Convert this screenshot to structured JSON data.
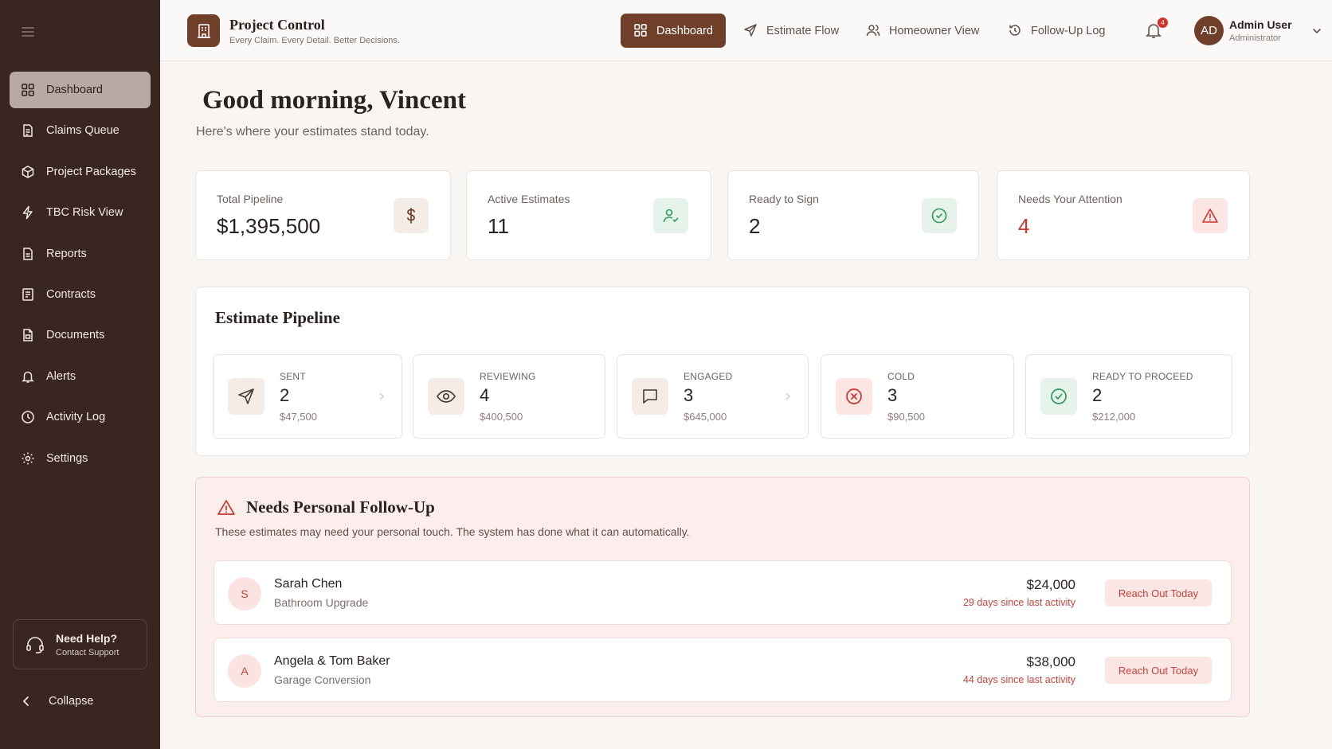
{
  "sidebar": {
    "items": [
      {
        "label": "Dashboard",
        "icon": "grid-icon",
        "active": true
      },
      {
        "label": "Claims Queue",
        "icon": "document-icon"
      },
      {
        "label": "Project Packages",
        "icon": "package-icon"
      },
      {
        "label": "TBC Risk View",
        "icon": "lightning-icon"
      },
      {
        "label": "Reports",
        "icon": "report-icon"
      },
      {
        "label": "Contracts",
        "icon": "contract-icon"
      },
      {
        "label": "Documents",
        "icon": "documents-icon"
      },
      {
        "label": "Alerts",
        "icon": "bell-icon"
      },
      {
        "label": "Activity Log",
        "icon": "clock-icon"
      },
      {
        "label": "Settings",
        "icon": "gear-icon"
      }
    ],
    "help": {
      "title": "Need Help?",
      "subtitle": "Contact Support"
    },
    "collapse_label": "Collapse"
  },
  "header": {
    "brand_title": "Project Control",
    "brand_subtitle": "Every Claim. Every Detail. Better Decisions.",
    "nav": [
      {
        "label": "Dashboard",
        "icon": "grid-icon",
        "active": true
      },
      {
        "label": "Estimate Flow",
        "icon": "send-icon"
      },
      {
        "label": "Homeowner View",
        "icon": "users-icon"
      },
      {
        "label": "Follow-Up Log",
        "icon": "history-icon"
      }
    ],
    "notification_count": "4",
    "user": {
      "initials": "AD",
      "name": "Admin User",
      "role": "Administrator"
    }
  },
  "main": {
    "greeting": "Good morning, Vincent",
    "subtitle": "Here's where your estimates stand today.",
    "stats": [
      {
        "label": "Total Pipeline",
        "value": "$1,395,500",
        "icon": "dollar-icon"
      },
      {
        "label": "Active Estimates",
        "value": "11",
        "icon": "user-check-icon"
      },
      {
        "label": "Ready to Sign",
        "value": "2",
        "icon": "check-circle-icon"
      },
      {
        "label": "Needs Your Attention",
        "value": "4",
        "icon": "warning-icon"
      }
    ],
    "pipeline": {
      "title": "Estimate Pipeline",
      "stages": [
        {
          "name": "SENT",
          "count": "2",
          "amount": "$47,500",
          "icon": "send-icon"
        },
        {
          "name": "REVIEWING",
          "count": "4",
          "amount": "$400,500",
          "icon": "eye-icon"
        },
        {
          "name": "ENGAGED",
          "count": "3",
          "amount": "$645,000",
          "icon": "chat-icon"
        },
        {
          "name": "COLD",
          "count": "3",
          "amount": "$90,500",
          "icon": "x-circle-icon"
        },
        {
          "name": "READY TO PROCEED",
          "count": "2",
          "amount": "$212,000",
          "icon": "check-circle-icon"
        }
      ]
    },
    "followup": {
      "title": "Needs Personal Follow-Up",
      "description": "These estimates may need your personal touch. The system has done what it can automatically.",
      "rows": [
        {
          "initial": "S",
          "name": "Sarah Chen",
          "project": "Bathroom Upgrade",
          "amount": "$24,000",
          "days": "29 days since last activity",
          "action": "Reach Out Today"
        },
        {
          "initial": "A",
          "name": "Angela & Tom Baker",
          "project": "Garage Conversion",
          "amount": "$38,000",
          "days": "44 days since last activity",
          "action": "Reach Out Today"
        }
      ]
    }
  },
  "colors": {
    "sidebar_bg": "#3a2620",
    "accent": "#6f3f2a",
    "danger": "#d0342c",
    "success": "#2f9a5c"
  }
}
